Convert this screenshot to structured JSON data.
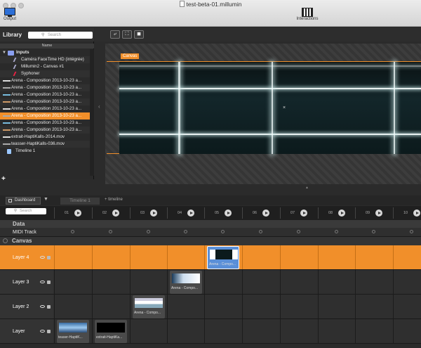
{
  "window": {
    "title": "test-beta-01.millumin"
  },
  "toolbar": {
    "output_label": "Output",
    "interactions_label": "Interactions"
  },
  "library": {
    "title": "Library",
    "search_placeholder": "Search",
    "column_header": "Name",
    "items": [
      {
        "label": "Inputs",
        "kind": "folder"
      },
      {
        "label": "Caméra FaceTime HD (intégrée)",
        "kind": "camera"
      },
      {
        "label": "Millumin2 - Canvas #1",
        "kind": "syphon"
      },
      {
        "label": "Syphoner",
        "kind": "syphon"
      },
      {
        "label": "Arena - Composition 2013-10-23 a...",
        "kind": "media"
      },
      {
        "label": "Arena - Composition 2013-10-23 a...",
        "kind": "media"
      },
      {
        "label": "Arena - Composition 2013-10-23 a...",
        "kind": "media"
      },
      {
        "label": "Arena - Composition 2013-10-23 a...",
        "kind": "media"
      },
      {
        "label": "Arena - Composition 2013-10-23 a...",
        "kind": "media"
      },
      {
        "label": "Arena - Composition 2013-10-23 a...",
        "kind": "media",
        "selected": true
      },
      {
        "label": "Arena - Composition 2013-10-23 a...",
        "kind": "media"
      },
      {
        "label": "Arena - Composition 2013-10-23 a...",
        "kind": "media"
      },
      {
        "label": "extrait-HaptiKalls-2014.mov",
        "kind": "media"
      },
      {
        "label": "teasser-HaptiKalls-036.mov",
        "kind": "media"
      },
      {
        "label": "Timeline 1",
        "kind": "timeline"
      }
    ],
    "add_label": "+"
  },
  "canvas": {
    "label": "Canvas"
  },
  "tabs": {
    "dashboard": "Dashboard",
    "timeline": "Timeline 1",
    "add_timeline": "+ timeline"
  },
  "dashboard": {
    "search_placeholder": "Search",
    "columns": [
      "01",
      "02",
      "03",
      "04",
      "05",
      "06",
      "07",
      "08",
      "09",
      "10"
    ],
    "sections": {
      "data": "Data",
      "canvas": "Canvas"
    },
    "midi_track": "MIDI Track",
    "layers": [
      {
        "name": "Layer 4",
        "active": true,
        "clips": [
          {
            "col": 4,
            "name": "Arena - Compo..."
          }
        ]
      },
      {
        "name": "Layer 3",
        "active": false,
        "clips": [
          {
            "col": 3,
            "name": "Arena - Compo..."
          }
        ]
      },
      {
        "name": "Layer 2",
        "active": false,
        "clips": [
          {
            "col": 2,
            "name": "Arena - Compo..."
          }
        ]
      },
      {
        "name": "Layer",
        "active": false,
        "clips": [
          {
            "col": 0,
            "name": "teaser-HaptiK..."
          },
          {
            "col": 1,
            "name": "extrait-HaptiKa..."
          }
        ]
      }
    ]
  },
  "colors": {
    "accent": "#f18f2a",
    "selection": "#5a8fd8"
  }
}
